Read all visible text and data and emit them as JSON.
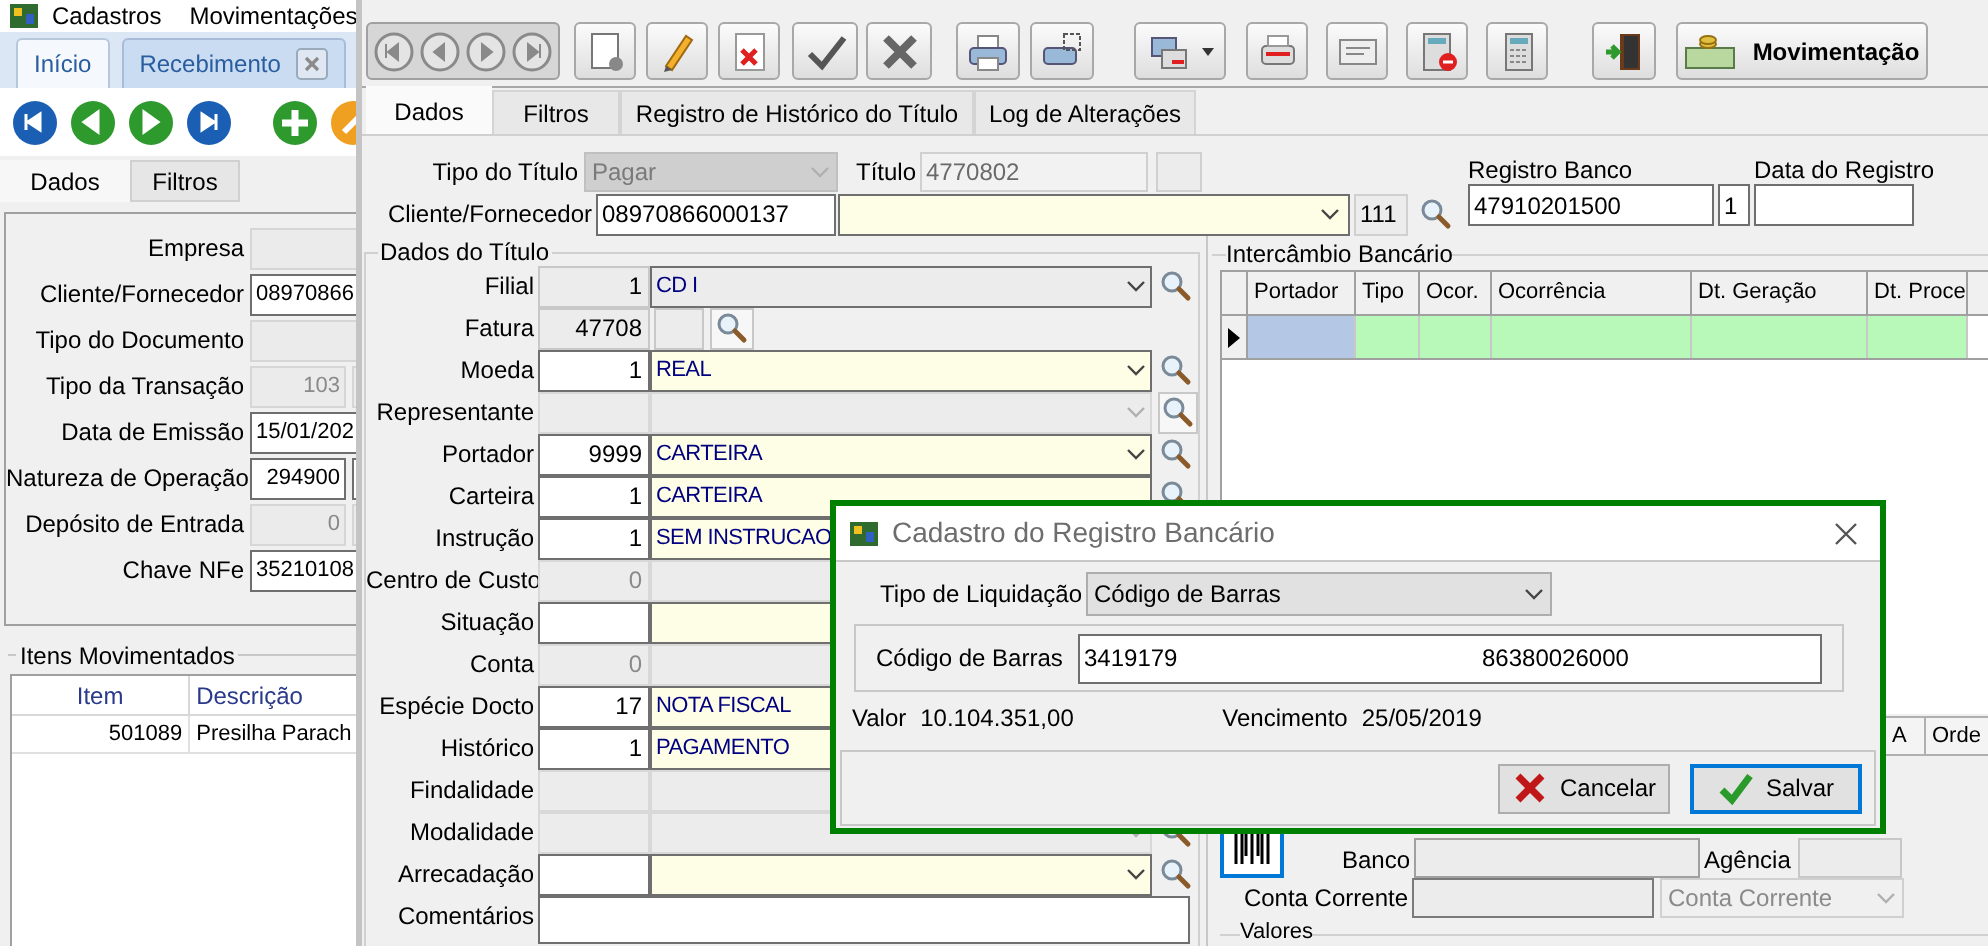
{
  "back_window": {
    "menu": [
      "Cadastros",
      "Movimentações"
    ],
    "tabs": [
      {
        "label": "Início",
        "selected": true,
        "closable": false
      },
      {
        "label": "Recebimento",
        "selected": false,
        "closable": true
      }
    ],
    "subtabs": [
      {
        "label": "Dados",
        "selected": true
      },
      {
        "label": "Filtros",
        "selected": false
      }
    ],
    "fields": [
      {
        "label": "Empresa",
        "kind": "text",
        "disabled": true
      },
      {
        "label": "Cliente/Fornecedor",
        "kind": "text",
        "disabled": false,
        "value": "08970866"
      },
      {
        "label": "Tipo do Documento",
        "kind": "text",
        "disabled": true
      },
      {
        "label": "Tipo da Transação",
        "kind": "code",
        "disabled": true,
        "value": "103"
      },
      {
        "label": "Data de Emissão",
        "kind": "text",
        "disabled": false,
        "value": "15/01/202"
      },
      {
        "label": "Natureza de Operação",
        "kind": "code",
        "disabled": false,
        "value": "294900"
      },
      {
        "label": "Depósito de Entrada",
        "kind": "code",
        "disabled": true,
        "value": "0"
      },
      {
        "label": "Chave NFe",
        "kind": "text",
        "disabled": false,
        "value": "35210108"
      }
    ],
    "items": {
      "title": "Itens Movimentados",
      "columns": [
        "Item",
        "Descrição"
      ],
      "rows": [
        [
          "501089",
          "Presilha Parach"
        ]
      ]
    }
  },
  "main_window": {
    "toolbar_button": "Movimentação",
    "tabs": [
      {
        "label": "Dados",
        "selected": true
      },
      {
        "label": "Filtros",
        "selected": false
      },
      {
        "label": "Registro de Histórico do Título",
        "selected": false
      },
      {
        "label": "Log de Alterações",
        "selected": false
      }
    ],
    "tipo_do_titulo": {
      "label": "Tipo do Título",
      "value": "Pagar",
      "disabled": true
    },
    "titulo": {
      "label": "Título",
      "value": "4770802"
    },
    "cliente_fornecedor": {
      "label": "Cliente/Fornecedor",
      "value": "08970866000137",
      "code": "111"
    },
    "registro_banco": {
      "label": "Registro Banco",
      "value": "47910201500",
      "sequence": "1"
    },
    "data_do_registro": {
      "label": "Data do Registro"
    },
    "dados_do_titulo": {
      "title": "Dados do Título",
      "rows": [
        {
          "label": "Filial",
          "kind": "pair",
          "code": "1",
          "name": "CD I",
          "readonly": true,
          "disabled": false,
          "dropdown": true,
          "search": true,
          "boxed": false
        },
        {
          "label": "Fatura",
          "kind": "fatura",
          "code": "47708",
          "readonly": true,
          "disabled": false,
          "dropdown": false,
          "search": true,
          "boxed": true
        },
        {
          "label": "Moeda",
          "kind": "pair",
          "code": "1",
          "name": "REAL",
          "readonly": false,
          "disabled": false,
          "dropdown": true,
          "search": true,
          "boxed": false
        },
        {
          "label": "Representante",
          "kind": "pair",
          "disabled": true,
          "dropdown": true,
          "search": true,
          "boxed": true
        },
        {
          "label": "Portador",
          "kind": "pair",
          "code": "9999",
          "name": "CARTEIRA",
          "readonly": false,
          "disabled": false,
          "dropdown": true,
          "search": true,
          "boxed": false
        },
        {
          "label": "Carteira",
          "kind": "pair",
          "code": "1",
          "name": "CARTEIRA",
          "readonly": false,
          "disabled": false,
          "dropdown": false,
          "search": true,
          "boxed": false
        },
        {
          "label": "Instrução",
          "kind": "pair",
          "code": "1",
          "name": "SEM INSTRUCAO",
          "readonly": false,
          "disabled": false,
          "dropdown": false,
          "search": false
        },
        {
          "label": "Centro de Custo",
          "kind": "pair",
          "code": "0",
          "disabled": true,
          "dropdown": false,
          "search": false
        },
        {
          "label": "Situação",
          "kind": "pair",
          "readonly": false,
          "disabled": false,
          "dropdown": false,
          "search": false
        },
        {
          "label": "Conta",
          "kind": "pair",
          "code": "0",
          "disabled": true,
          "dropdown": false,
          "search": false
        },
        {
          "label": "Espécie Docto",
          "kind": "pair",
          "code": "17",
          "name": "NOTA FISCAL",
          "readonly": false,
          "disabled": false,
          "dropdown": false,
          "search": false
        },
        {
          "label": "Histórico",
          "kind": "pair",
          "code": "1",
          "name": "PAGAMENTO",
          "readonly": false,
          "disabled": false,
          "dropdown": false,
          "search": false
        },
        {
          "label": "Findalidade",
          "kind": "pair",
          "disabled": true,
          "dropdown": false,
          "search": false
        },
        {
          "label": "Modalidade",
          "kind": "pair",
          "disabled": true,
          "dropdown": true,
          "search": true,
          "boxed": false
        },
        {
          "label": "Arrecadação",
          "kind": "pair",
          "readonly": false,
          "disabled": false,
          "dropdown": true,
          "search": true,
          "boxed": false
        },
        {
          "label": "Comentários",
          "kind": "memo",
          "readonly": false,
          "disabled": false,
          "dropdown": false,
          "search": false
        }
      ]
    },
    "intercambio_bancario": {
      "title": "Intercâmbio Bancário",
      "columns": [
        "Portador",
        "Tipo",
        "Ocor.",
        "Ocorrência",
        "Dt. Geração",
        "Dt. Proce"
      ],
      "rows": [
        {
          "selected": true
        }
      ]
    },
    "lower_columns": [
      "A",
      "Orde"
    ],
    "banco": {
      "label": "Banco"
    },
    "agencia": {
      "label": "Agência"
    },
    "conta_corrente": {
      "label": "Conta Corrente",
      "selection": "Conta Corrente",
      "disabled": true
    },
    "valores": {
      "title": "Valores"
    }
  },
  "dialog": {
    "title": "Cadastro do Registro Bancário",
    "tipo_de_liquidacao": {
      "label": "Tipo de Liquidação",
      "value": "Código de Barras"
    },
    "codigo_de_barras": {
      "label": "Código de Barras",
      "value_parts": [
        "3419179",
        "86380026000"
      ]
    },
    "valor": {
      "label": "Valor",
      "value": "10.104.351,00"
    },
    "vencimento": {
      "label": "Vencimento",
      "value": "25/05/2019"
    },
    "buttons": [
      {
        "label": "Cancelar",
        "kind": "cancel",
        "focused": false
      },
      {
        "label": "Salvar",
        "kind": "save",
        "focused": true
      }
    ]
  }
}
